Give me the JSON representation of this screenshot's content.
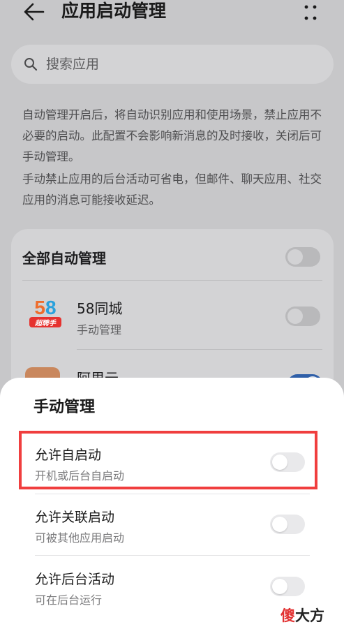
{
  "header": {
    "title": "应用启动管理",
    "back_icon": "back-arrow-icon",
    "more_icon": "more-vertical-icon"
  },
  "search": {
    "placeholder": "搜索应用",
    "icon": "search-icon"
  },
  "description": {
    "paragraph1": "自动管理开启后，将自动识别应用和使用场景，禁止应用不必要的启动。此配置不会影响新消息的及时接收，关闭后可手动管理。",
    "paragraph2": "手动禁止应用的后台活动可省电，但邮件、聊天应用、社交应用的消息可能接收延迟。"
  },
  "app_list": {
    "all_auto_label": "全部自动管理",
    "all_auto_on": false,
    "apps": [
      {
        "name": "58同城",
        "mode": "手动管理",
        "auto_on": false,
        "icon_text": "58",
        "icon_tag": "超聘手"
      },
      {
        "name": "阿里云",
        "auto_on": true
      }
    ]
  },
  "sheet": {
    "title": "手动管理",
    "options": [
      {
        "title": "允许自启动",
        "subtitle": "开机或后台自启动",
        "on": false
      },
      {
        "title": "允许关联启动",
        "subtitle": "可被其他应用启动",
        "on": false
      },
      {
        "title": "允许后台活动",
        "subtitle": "可在后台运行",
        "on": false
      }
    ]
  },
  "watermark": {
    "char1": "傻",
    "rest": "大方"
  },
  "colors": {
    "highlight": "#f03e3e",
    "toggle_on": "#2f5fa8",
    "sheet_bg": "#ffffff"
  }
}
